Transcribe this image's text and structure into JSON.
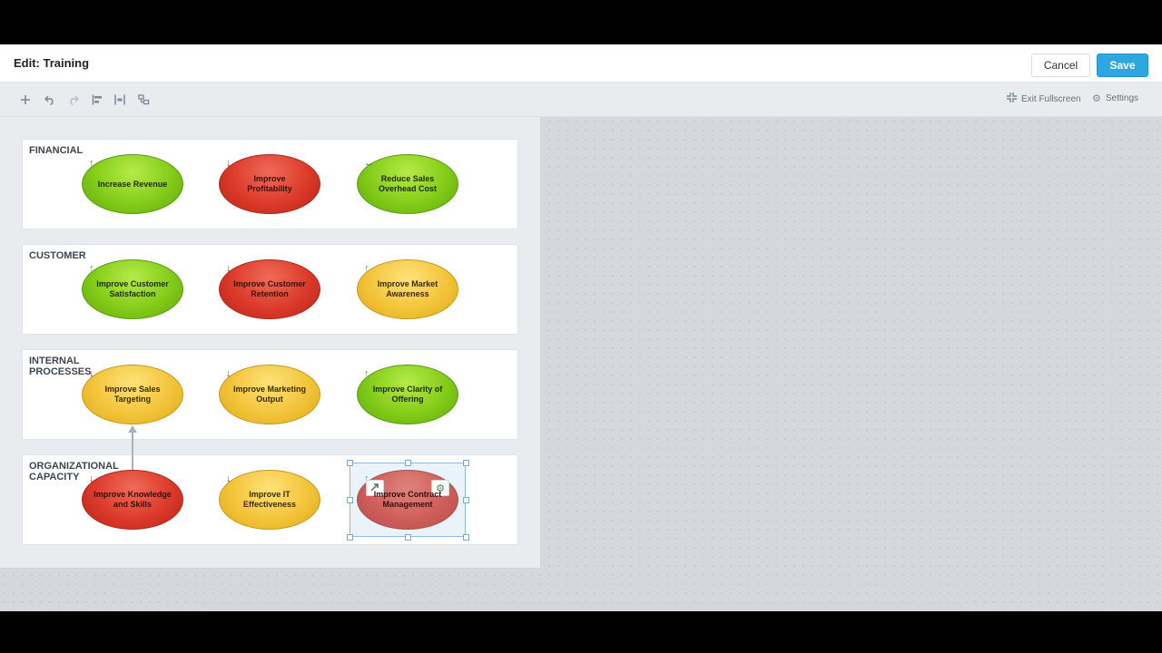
{
  "header": {
    "title": "Edit: Training",
    "cancel_label": "Cancel",
    "save_label": "Save",
    "save_color": "#2ea7e0"
  },
  "toolbar": {
    "icons": [
      "add-icon",
      "undo-icon",
      "redo-icon",
      "align-left-icon",
      "distribute-icon",
      "group-icon"
    ],
    "exit_fullscreen_label": "Exit Fullscreen",
    "settings_label": "Settings"
  },
  "lanes": [
    {
      "label": "FINANCIAL",
      "objectives": [
        {
          "name": "Increase Revenue",
          "status": "green",
          "trend": "up"
        },
        {
          "name": "Improve Profitability",
          "status": "red",
          "trend": "down"
        },
        {
          "name": "Reduce Sales Overhead Cost",
          "status": "green",
          "trend": "flat"
        }
      ]
    },
    {
      "label": "CUSTOMER",
      "objectives": [
        {
          "name": "Improve Customer Satisfaction",
          "status": "green",
          "trend": "up"
        },
        {
          "name": "Improve Customer Retention",
          "status": "red",
          "trend": "down"
        },
        {
          "name": "Improve Market Awareness",
          "status": "yellow",
          "trend": "up"
        }
      ]
    },
    {
      "label": "INTERNAL PROCESSES",
      "objectives": [
        {
          "name": "Improve Sales Targeting",
          "status": "yellow",
          "trend": "down"
        },
        {
          "name": "Improve Marketing Output",
          "status": "yellow",
          "trend": "down"
        },
        {
          "name": "Improve Clarity of Offering",
          "status": "green",
          "trend": "up"
        }
      ]
    },
    {
      "label": "ORGANIZATIONAL CAPACITY",
      "objectives": [
        {
          "name": "Improve Knowledge and Skills",
          "status": "red",
          "trend": "down"
        },
        {
          "name": "Improve IT Effectiveness",
          "status": "yellow",
          "trend": "down"
        },
        {
          "name": "Improve Contract Management",
          "status": "red",
          "trend": "up"
        }
      ]
    }
  ],
  "trend_glyphs": {
    "up": "↑",
    "down": "↓",
    "flat": "↔"
  },
  "status_colors": {
    "green": "#84cc18",
    "red": "#dc3a2a",
    "yellow": "#f3c43a"
  }
}
